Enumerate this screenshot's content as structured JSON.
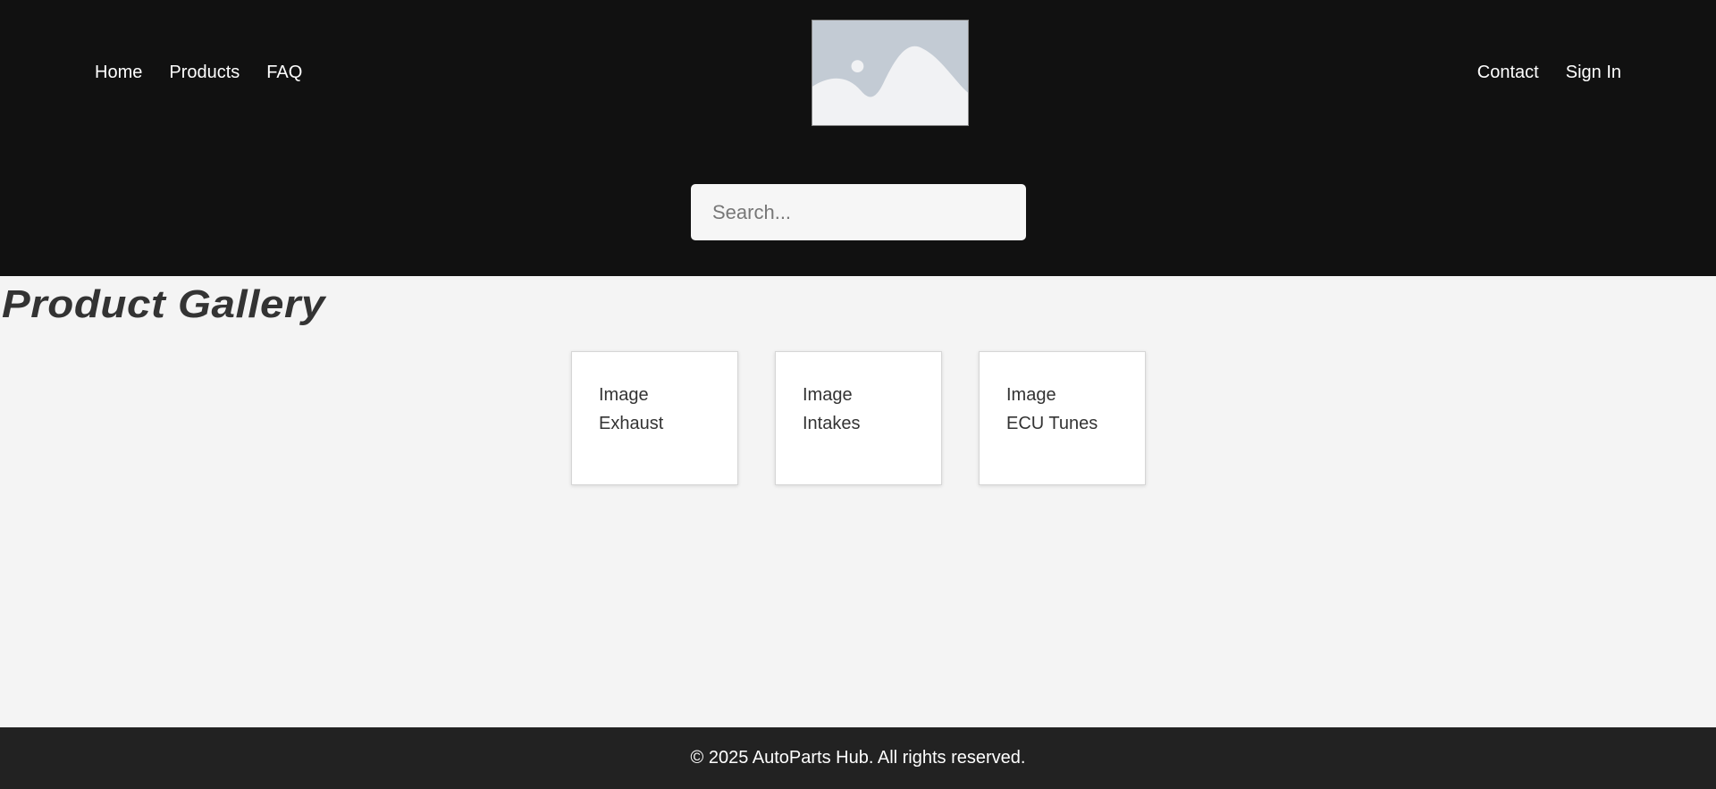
{
  "header": {
    "nav_left": [
      "Home",
      "Products",
      "FAQ"
    ],
    "nav_right": [
      "Contact",
      "Sign In"
    ],
    "logo_icon": "image-placeholder-icon",
    "search": {
      "placeholder": "Search...",
      "value": ""
    }
  },
  "main": {
    "title": "Product Gallery",
    "cards": [
      {
        "image_label": "Image",
        "name": "Exhaust"
      },
      {
        "image_label": "Image",
        "name": "Intakes"
      },
      {
        "image_label": "Image",
        "name": "ECU Tunes"
      }
    ]
  },
  "footer": {
    "text": "© 2025 AutoParts Hub. All rights reserved."
  },
  "colors": {
    "header_bg": "#111111",
    "page_bg": "#f4f4f4",
    "footer_bg": "#222222",
    "title_color": "#333333"
  }
}
